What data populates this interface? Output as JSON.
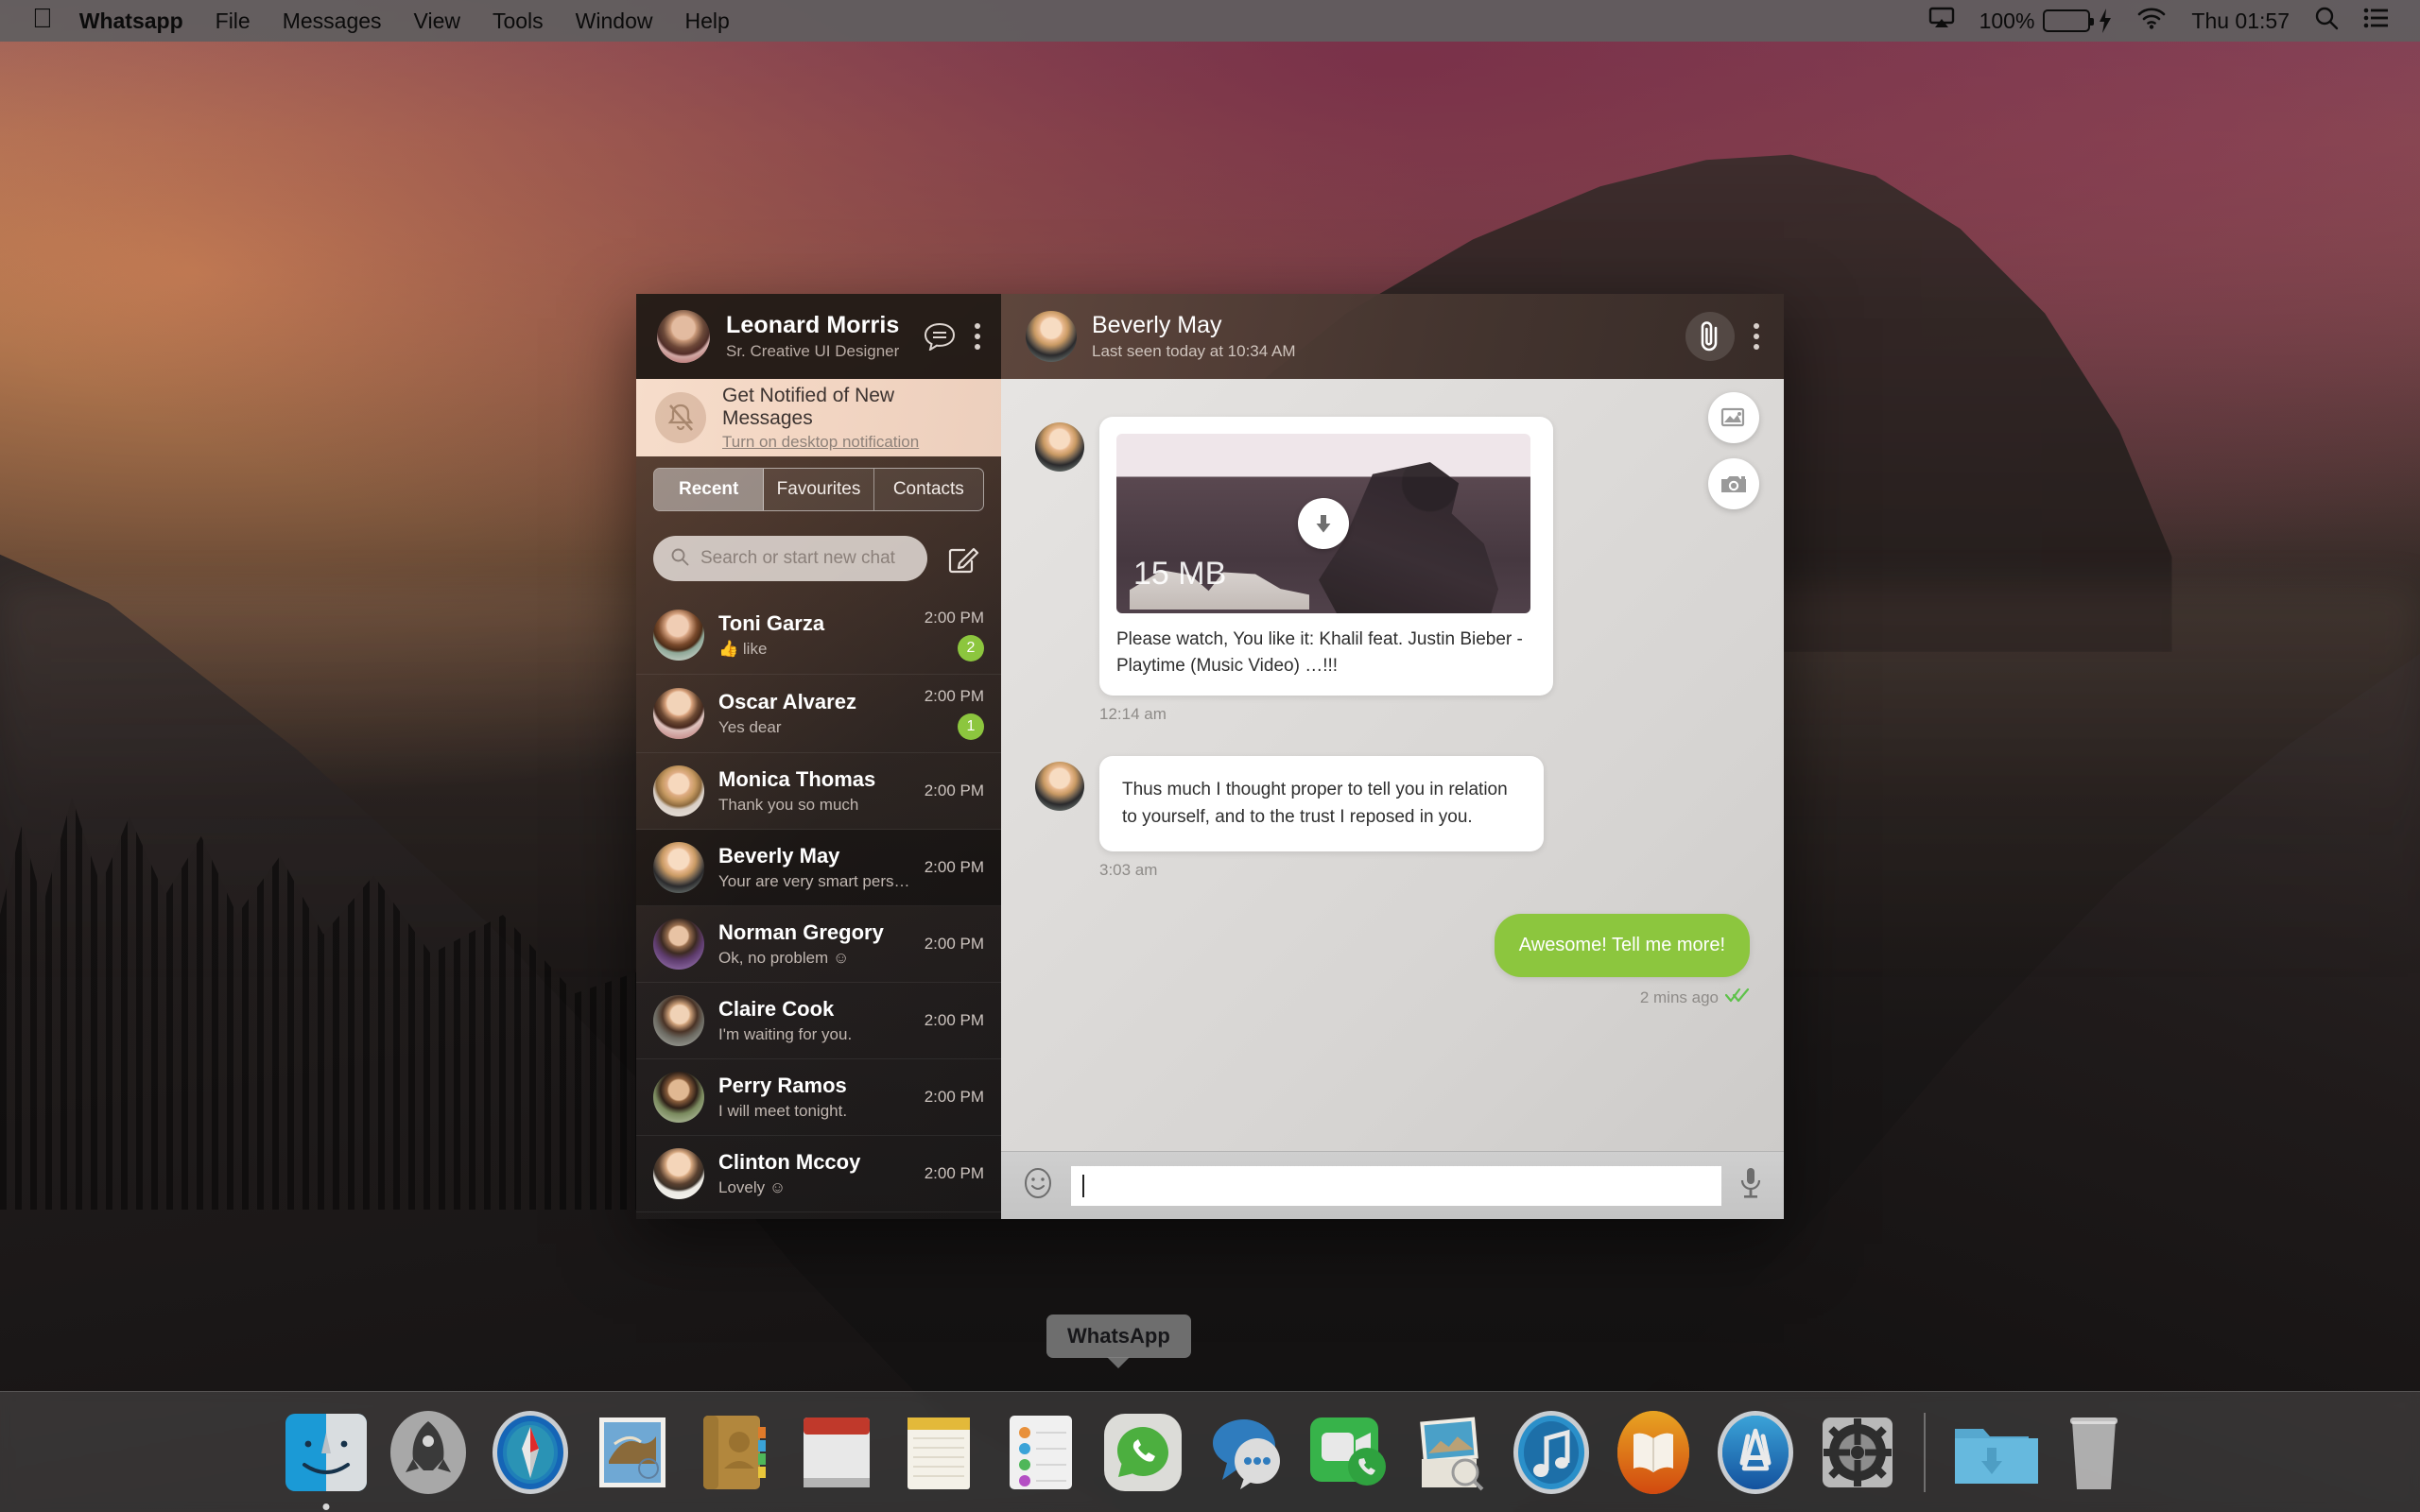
{
  "menubar": {
    "apple_glyph": "",
    "items": [
      "Whatsapp",
      "File",
      "Messages",
      "View",
      "Tools",
      "Window",
      "Help"
    ],
    "battery_percent": "100%",
    "clock": "Thu 01:57",
    "icons": [
      "airplay-icon",
      "battery-icon",
      "wifi-icon",
      "search-icon",
      "notification-center-icon"
    ]
  },
  "window": {
    "sidebar": {
      "profile": {
        "name": "Leonard Morris",
        "role": "Sr. Creative UI Designer"
      },
      "notification": {
        "title": "Get Notified of New Messages",
        "link": "Turn on desktop notification"
      },
      "tabs": [
        {
          "label": "Recent",
          "active": true
        },
        {
          "label": "Favourites",
          "active": false
        },
        {
          "label": "Contacts",
          "active": false
        }
      ],
      "search_placeholder": "Search or start new chat",
      "search_value": "",
      "chats": [
        {
          "name": "Toni Garza",
          "msg": "👍 like",
          "time": "2:00 PM",
          "badge": "2",
          "active": false
        },
        {
          "name": "Oscar Alvarez",
          "msg": "Yes dear",
          "time": "2:00 PM",
          "badge": "1",
          "active": false
        },
        {
          "name": "Monica Thomas",
          "msg": "Thank you so much",
          "time": "2:00 PM",
          "badge": "",
          "active": false
        },
        {
          "name": "Beverly May",
          "msg": "Your are very smart person…",
          "time": "2:00 PM",
          "badge": "",
          "active": true
        },
        {
          "name": "Norman Gregory",
          "msg": "Ok, no problem ☺",
          "time": "2:00 PM",
          "badge": "",
          "active": false
        },
        {
          "name": "Claire Cook",
          "msg": "I'm waiting for you.",
          "time": "2:00 PM",
          "badge": "",
          "active": false
        },
        {
          "name": "Perry Ramos",
          "msg": "I will meet tonight.",
          "time": "2:00 PM",
          "badge": "",
          "active": false
        },
        {
          "name": "Clinton Mccoy",
          "msg": "Lovely ☺",
          "time": "2:00 PM",
          "badge": "",
          "active": false
        }
      ]
    },
    "chat": {
      "header": {
        "name": "Beverly May",
        "status": "Last seen today at 10:34 AM"
      },
      "messages": [
        {
          "dir": "in",
          "media_size": "15 MB",
          "caption": "Please watch, You like it: Khalil feat. Justin Bieber - Playtime (Music Video) …!!!",
          "time": "12:14 am"
        },
        {
          "dir": "in",
          "text": "Thus much I thought proper to tell you in relation to yourself, and to the trust I reposed in you.",
          "time": "3:03 am"
        },
        {
          "dir": "out",
          "text": "Awesome! Tell me more!",
          "time": "2 mins ago",
          "read_receipt": "double-check"
        }
      ],
      "input_placeholder": "",
      "input_value": "",
      "fabs": [
        "image-icon",
        "camera-icon"
      ]
    }
  },
  "dock": {
    "tooltip": "WhatsApp",
    "items": [
      "finder",
      "launchpad",
      "safari",
      "mail",
      "contacts",
      "calendar",
      "notes",
      "reminders",
      "whatsapp",
      "messages",
      "facetime",
      "photos",
      "itunes",
      "ibooks",
      "app-store",
      "system-preferences",
      "downloads",
      "trash"
    ]
  },
  "colors": {
    "accent_green": "#8cc63e",
    "notif_banner": "#f3d6c3",
    "menubar": "#605e5f"
  }
}
